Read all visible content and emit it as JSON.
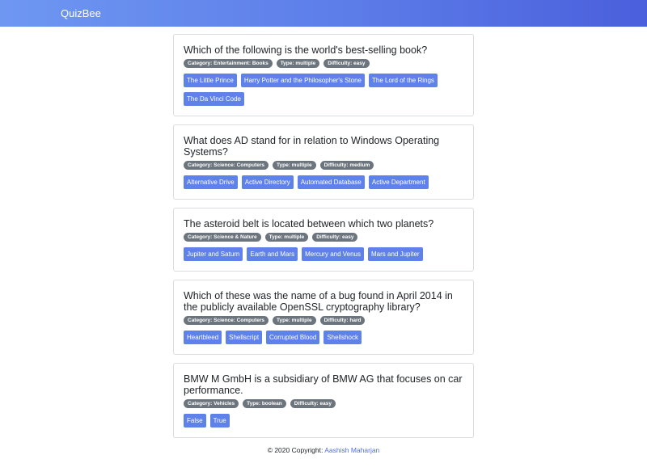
{
  "navbar": {
    "brand": "QuizBee"
  },
  "questions": [
    {
      "text": "Which of the following is the world's best-selling book?",
      "category": "Category: Entertainment: Books",
      "type": "Type: multiple",
      "difficulty": "Difficulty: easy",
      "answers": [
        "The Little Prince",
        "Harry Potter and the Philosopher's Stone",
        "The Lord of the Rings",
        "The Da Vinci Code"
      ]
    },
    {
      "text": "What does AD stand for in relation to Windows Operating Systems?",
      "category": "Category: Science: Computers",
      "type": "Type: multiple",
      "difficulty": "Difficulty: medium",
      "answers": [
        "Alternative Drive",
        "Active Directory",
        "Automated Database",
        "Active Department"
      ]
    },
    {
      "text": "The asteroid belt is located between which two planets?",
      "category": "Category: Science & Nature",
      "type": "Type: multiple",
      "difficulty": "Difficulty: easy",
      "answers": [
        "Jupiter and Saturn",
        "Earth and Mars",
        "Mercury and Venus",
        "Mars and Jupiter"
      ]
    },
    {
      "text": "Which of these was the name of a bug found in April 2014 in the publicly available OpenSSL cryptography library?",
      "category": "Category: Science: Computers",
      "type": "Type: multiple",
      "difficulty": "Difficulty: hard",
      "answers": [
        "Heartbleed",
        "Shellscript",
        "Corrupted Blood",
        "Shellshock"
      ]
    },
    {
      "text": "BMW M GmbH is a subsidiary of BMW AG that focuses on car performance.",
      "category": "Category: Vehicles",
      "type": "Type: boolean",
      "difficulty": "Difficulty: easy",
      "answers": [
        "False",
        "True"
      ]
    }
  ],
  "footer": {
    "copyright": "© 2020 Copyright:",
    "author": "Aashish Maharjan"
  },
  "colors": {
    "accent": "#5e82e9",
    "badge": "#6c757d",
    "navbar_start": "#6e97f2",
    "navbar_end": "#4a5fdc"
  }
}
